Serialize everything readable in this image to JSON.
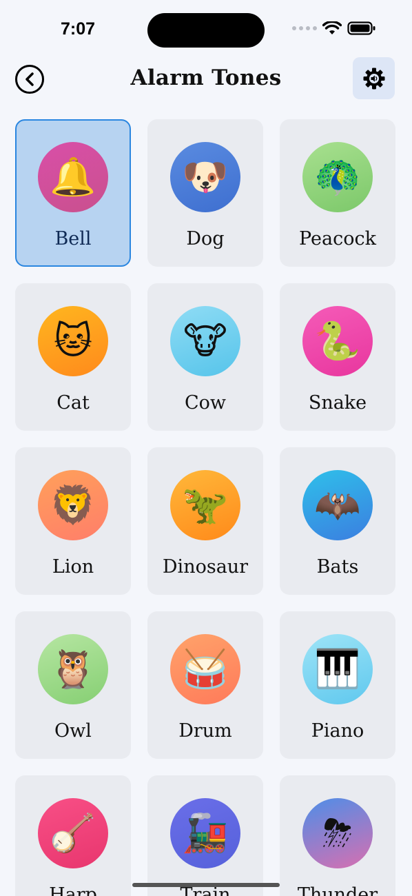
{
  "status_bar": {
    "time": "7:07"
  },
  "header": {
    "title": "Alarm Tones",
    "back_icon": "chevron-left-circle-icon",
    "settings_icon": "gear-speaker-icon"
  },
  "colors": {
    "background": "#f4f6fb",
    "tile": "#e9ebf0",
    "selected_tile": "#b7d3f1",
    "selected_border": "#2a86e0",
    "settings_bg": "#dde6f6"
  },
  "tones": [
    {
      "label": "Bell",
      "icon": "bell-icon",
      "selected": true,
      "gradient": [
        "#d94fa8",
        "#c9508e"
      ]
    },
    {
      "label": "Dog",
      "icon": "dog-icon",
      "selected": false,
      "gradient": [
        "#5a8be0",
        "#3e6fd0"
      ]
    },
    {
      "label": "Peacock",
      "icon": "peacock-icon",
      "selected": false,
      "gradient": [
        "#a8e08f",
        "#7cc86a"
      ]
    },
    {
      "label": "Cat",
      "icon": "cat-icon",
      "selected": false,
      "gradient": [
        "#ffb61f",
        "#ff8a1c"
      ]
    },
    {
      "label": "Cow",
      "icon": "cow-icon",
      "selected": false,
      "gradient": [
        "#8fdcf5",
        "#56c4ea"
      ]
    },
    {
      "label": "Snake",
      "icon": "snake-icon",
      "selected": false,
      "gradient": [
        "#f55bb8",
        "#e8369e"
      ]
    },
    {
      "label": "Lion",
      "icon": "lion-icon",
      "selected": false,
      "gradient": [
        "#ffa05a",
        "#ff7e6a"
      ]
    },
    {
      "label": "Dinosaur",
      "icon": "dinosaur-icon",
      "selected": false,
      "gradient": [
        "#ffb83a",
        "#ff8a1a"
      ]
    },
    {
      "label": "Bats",
      "icon": "bat-icon",
      "selected": false,
      "gradient": [
        "#2fc0ea",
        "#3b7ee0"
      ]
    },
    {
      "label": "Owl",
      "icon": "owl-icon",
      "selected": false,
      "gradient": [
        "#b6e6a2",
        "#86cf73"
      ]
    },
    {
      "label": "Drum",
      "icon": "drum-icon",
      "selected": false,
      "gradient": [
        "#ffa36a",
        "#ff7a5a"
      ]
    },
    {
      "label": "Piano",
      "icon": "piano-icon",
      "selected": false,
      "gradient": [
        "#9ee4f7",
        "#5fc8ee"
      ]
    },
    {
      "label": "Harp",
      "icon": "harp-icon",
      "selected": false,
      "gradient": [
        "#f84f86",
        "#e8366e"
      ]
    },
    {
      "label": "Train",
      "icon": "train-icon",
      "selected": false,
      "gradient": [
        "#6a6ee8",
        "#5661db"
      ]
    },
    {
      "label": "Thunder",
      "icon": "thunder-cloud-icon",
      "selected": false,
      "gradient": [
        "#4d8ee8",
        "#d86fb0"
      ]
    }
  ]
}
